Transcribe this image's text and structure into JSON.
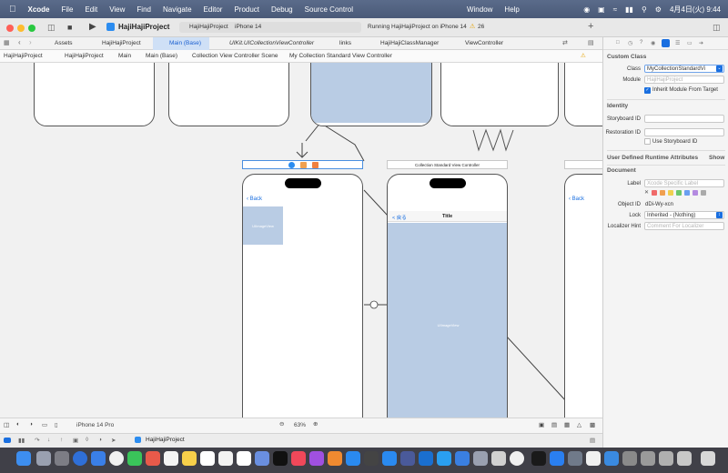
{
  "menubar": {
    "app": "Xcode",
    "items": [
      "File",
      "Edit",
      "View",
      "Find",
      "Navigate",
      "Editor",
      "Product",
      "Debug",
      "Source Control",
      "Window",
      "Help"
    ],
    "clock": "4月4日(火)  9:44"
  },
  "toolbar": {
    "project": "HajiHajiProject",
    "scheme": "HajiHajiProject",
    "device": "iPhone 14",
    "status": "Running HajiHajiProject on iPhone 14",
    "warnings": "26"
  },
  "tabs": [
    "Assets",
    "HajiHajiProject",
    "Main (Base)",
    "UIKit.UICollectionViewController",
    "links",
    "HajiHajiClassManager",
    "ViewController"
  ],
  "jumpbar": [
    "HajiHajiProject",
    "HajiHajiProject",
    "Main",
    "Main (Base)",
    "Collection View Controller Scene",
    "My Collection Standard View Controller"
  ],
  "canvas": {
    "scene2_title": "Collection Standard View Controller",
    "back": "Back",
    "back_jp": "< 戻る",
    "nav_title": "Title",
    "imageview": "UIImageView",
    "device_label": "iPhone 14 Pro",
    "zoom": "63%"
  },
  "debugbar": {
    "target": "HajiHajiProject"
  },
  "inspector": {
    "custom_class": "Custom Class",
    "class_label": "Class",
    "class_value": "MyCollectionStandardVi",
    "module_label": "Module",
    "module_placeholder": "HajiHajiProject",
    "inherit": "Inherit Module From Target",
    "identity": "Identity",
    "storyboard_id": "Storyboard ID",
    "restoration_id": "Restoration ID",
    "use_storyboard_id": "Use Storyboard ID",
    "udra": "User Defined Runtime Attributes",
    "show": "Show",
    "document": "Document",
    "label_label": "Label",
    "label_placeholder": "Xcode Specific Label",
    "object_id_label": "Object ID",
    "object_id": "dDi-Wy-xcn",
    "lock_label": "Lock",
    "lock_value": "Inherited - (Nothing)",
    "hint_label": "Localizer Hint",
    "hint_placeholder": "Comment For Localizer"
  },
  "colors": {
    "accent": "#1a6fe0",
    "imageview": "#b9cce4",
    "menubar": "#4f607f"
  }
}
